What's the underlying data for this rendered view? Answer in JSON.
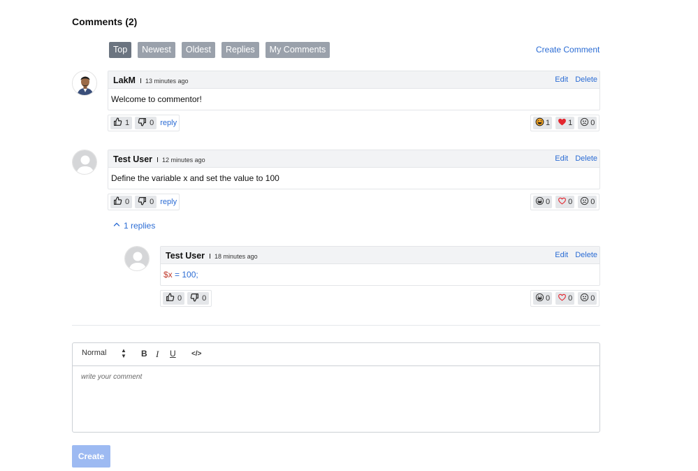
{
  "section": {
    "title": "Comments (2)"
  },
  "sort_tabs": [
    {
      "label": "Top",
      "active": true
    },
    {
      "label": "Newest",
      "active": false
    },
    {
      "label": "Oldest",
      "active": false
    },
    {
      "label": "Replies",
      "active": false
    },
    {
      "label": "My Comments",
      "active": false
    }
  ],
  "create_comment_label": "Create Comment",
  "actions": {
    "edit": "Edit",
    "delete": "Delete",
    "reply": "reply"
  },
  "comments": [
    {
      "author": "LakM",
      "time": "13 minutes ago",
      "text": "Welcome to commentor!",
      "likes": "1",
      "dislikes": "0",
      "reactions": {
        "laugh": "1",
        "heart": "1",
        "sad": "0"
      }
    },
    {
      "author": "Test User",
      "time": "12 minutes ago",
      "text": "Define the variable x and set the value to 100",
      "likes": "0",
      "dislikes": "0",
      "reactions": {
        "laugh": "0",
        "heart": "0",
        "sad": "0"
      },
      "replies_toggle": "1 replies",
      "replies": [
        {
          "author": "Test User",
          "time": "18 minutes ago",
          "code_var": "$x",
          "code_rest": " = 100;",
          "likes": "0",
          "dislikes": "0",
          "reactions": {
            "laugh": "0",
            "heart": "0",
            "sad": "0"
          }
        }
      ]
    }
  ],
  "editor": {
    "format_select": "Normal",
    "bold": "B",
    "italic": "I",
    "underline": "U",
    "code": "</>",
    "placeholder": "write your comment"
  },
  "submit_label": "Create",
  "colors": {
    "link": "#2b6cd4",
    "heart": "#e3262f",
    "active_tab": "#6b7480",
    "tab": "#9aa1ab",
    "submit": "#9dbaf2"
  }
}
